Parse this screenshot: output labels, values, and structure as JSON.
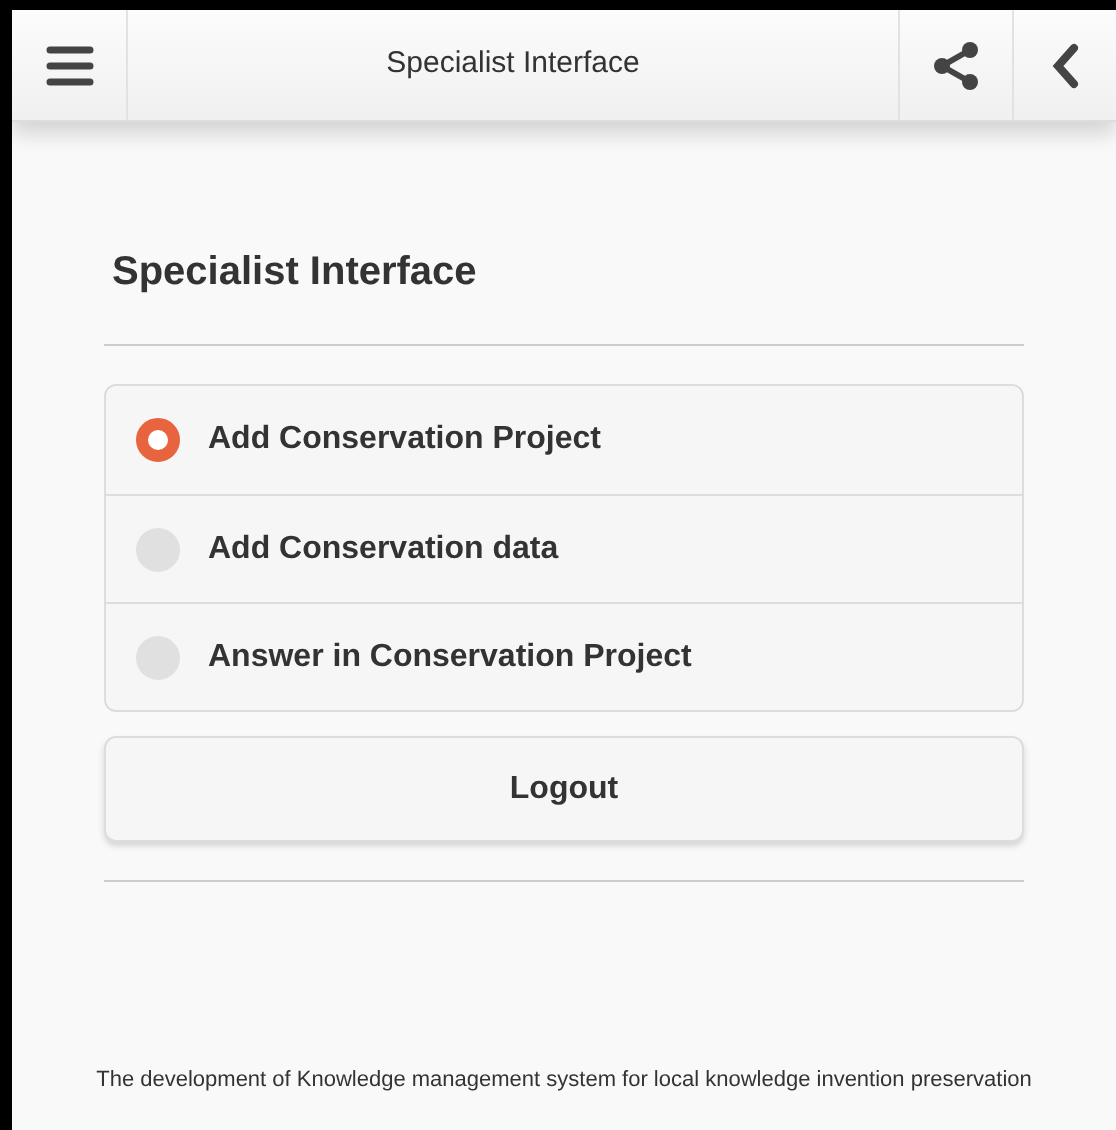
{
  "header": {
    "title": "Specialist Interface"
  },
  "heading": "Specialist Interface",
  "options": [
    {
      "label": "Add Conservation Project",
      "selected": true
    },
    {
      "label": "Add Conservation data",
      "selected": false
    },
    {
      "label": "Answer in Conservation Project",
      "selected": false
    }
  ],
  "logout_button": "Logout",
  "footer": "The development of Knowledge management system for local knowledge invention preservation"
}
